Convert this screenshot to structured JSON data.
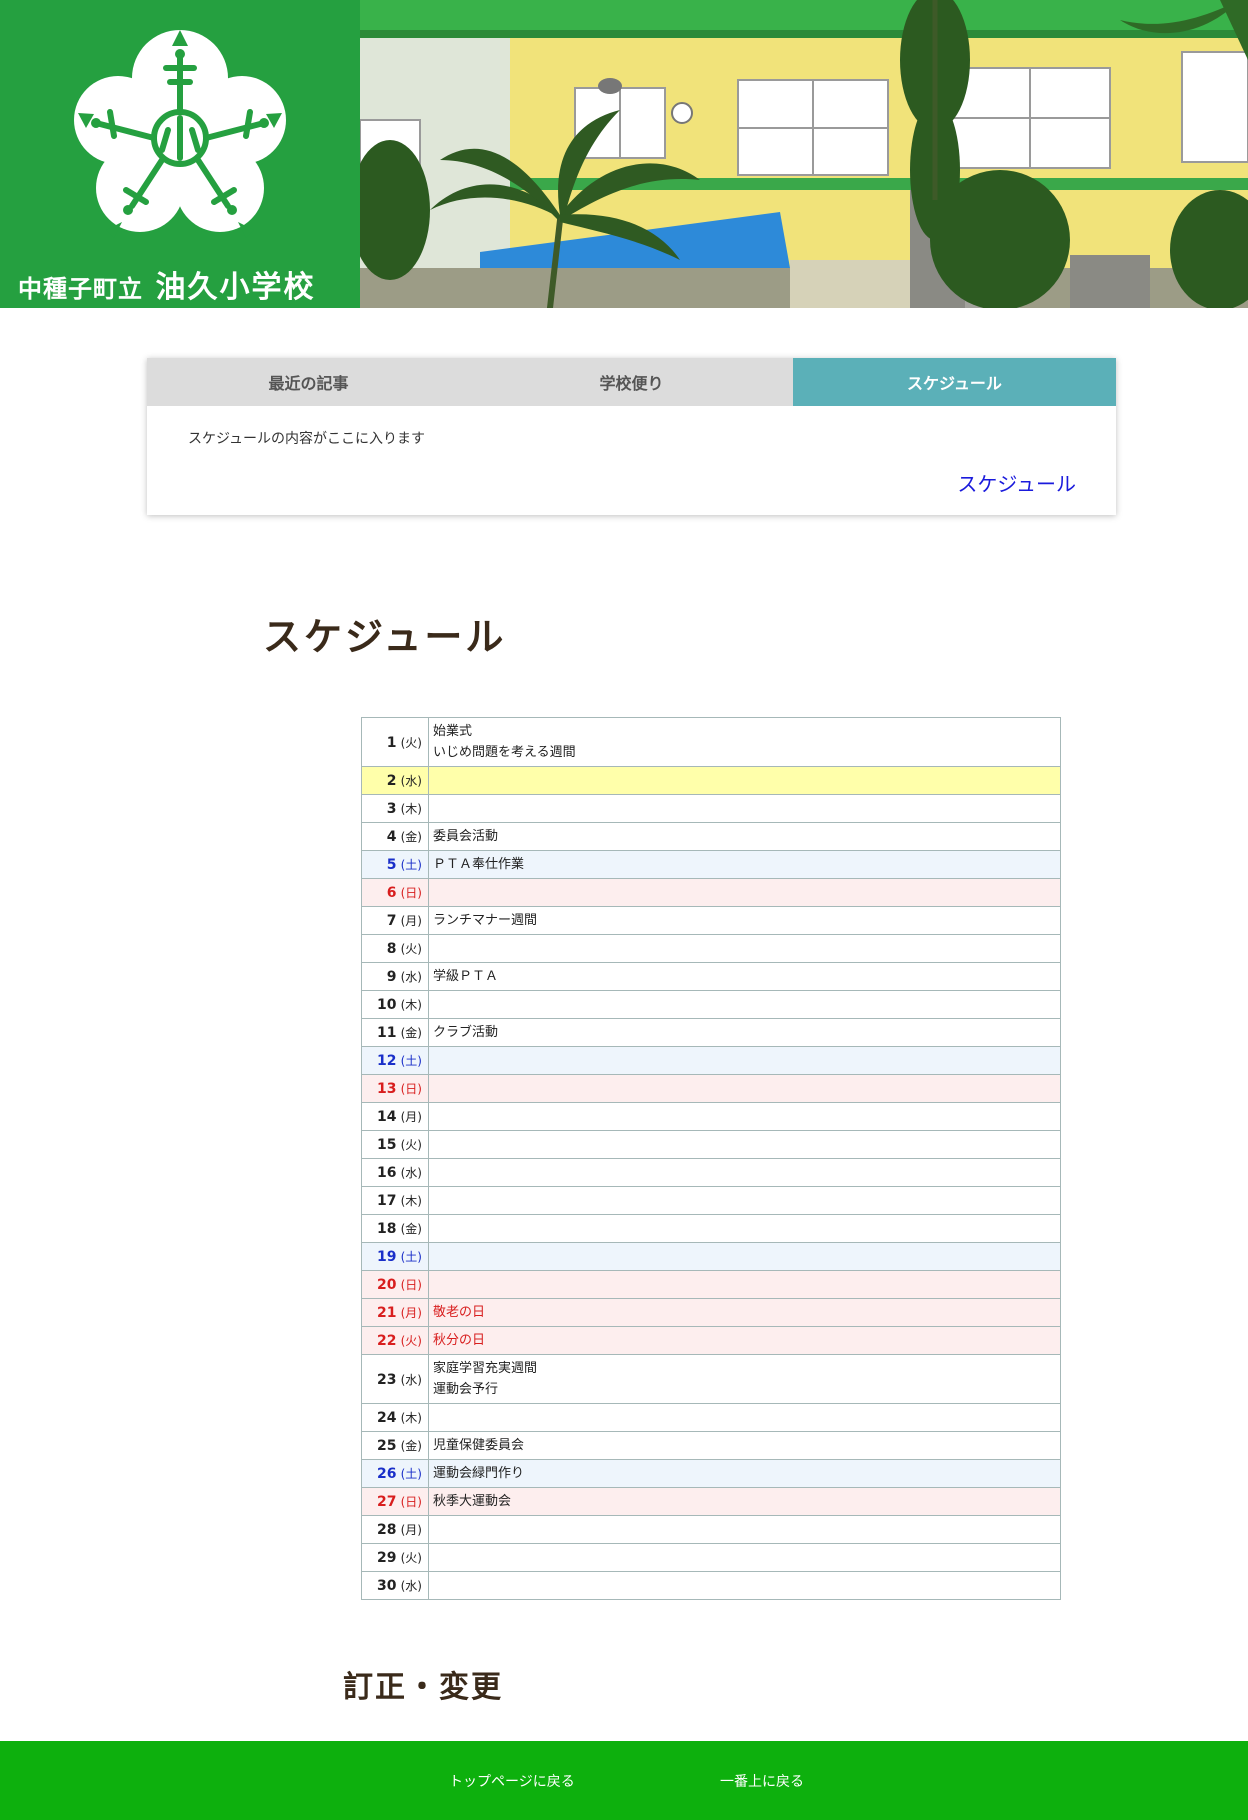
{
  "header": {
    "school_prefix": "中種子町立",
    "school_name": "油久小学校"
  },
  "tabs": {
    "items": [
      {
        "label": "最近の記事"
      },
      {
        "label": "学校便り"
      },
      {
        "label": "スケジュール"
      }
    ],
    "active_index": 2,
    "content_text": "スケジュールの内容がここに入ります",
    "more_link": "スケジュール"
  },
  "schedule": {
    "title": "スケジュール",
    "rows": [
      {
        "day": "1",
        "weekday": "(火)",
        "events": [
          "始業式",
          "いじめ問題を考える週間"
        ],
        "kind": "weekday"
      },
      {
        "day": "2",
        "weekday": "(水)",
        "events": [],
        "kind": "today"
      },
      {
        "day": "3",
        "weekday": "(木)",
        "events": [],
        "kind": "weekday"
      },
      {
        "day": "4",
        "weekday": "(金)",
        "events": [
          "委員会活動"
        ],
        "kind": "weekday"
      },
      {
        "day": "5",
        "weekday": "(土)",
        "events": [
          "ＰＴＡ奉仕作業"
        ],
        "kind": "sat"
      },
      {
        "day": "6",
        "weekday": "(日)",
        "events": [],
        "kind": "sun"
      },
      {
        "day": "7",
        "weekday": "(月)",
        "events": [
          "ランチマナー週間"
        ],
        "kind": "weekday"
      },
      {
        "day": "8",
        "weekday": "(火)",
        "events": [],
        "kind": "weekday"
      },
      {
        "day": "9",
        "weekday": "(水)",
        "events": [
          "学級ＰＴＡ"
        ],
        "kind": "weekday"
      },
      {
        "day": "10",
        "weekday": "(木)",
        "events": [],
        "kind": "weekday"
      },
      {
        "day": "11",
        "weekday": "(金)",
        "events": [
          "クラブ活動"
        ],
        "kind": "weekday"
      },
      {
        "day": "12",
        "weekday": "(土)",
        "events": [],
        "kind": "sat"
      },
      {
        "day": "13",
        "weekday": "(日)",
        "events": [],
        "kind": "sun"
      },
      {
        "day": "14",
        "weekday": "(月)",
        "events": [],
        "kind": "weekday"
      },
      {
        "day": "15",
        "weekday": "(火)",
        "events": [],
        "kind": "weekday"
      },
      {
        "day": "16",
        "weekday": "(水)",
        "events": [],
        "kind": "weekday"
      },
      {
        "day": "17",
        "weekday": "(木)",
        "events": [],
        "kind": "weekday"
      },
      {
        "day": "18",
        "weekday": "(金)",
        "events": [],
        "kind": "weekday"
      },
      {
        "day": "19",
        "weekday": "(土)",
        "events": [],
        "kind": "sat"
      },
      {
        "day": "20",
        "weekday": "(日)",
        "events": [],
        "kind": "sun"
      },
      {
        "day": "21",
        "weekday": "(月)",
        "events": [
          "敬老の日"
        ],
        "kind": "hol"
      },
      {
        "day": "22",
        "weekday": "(火)",
        "events": [
          "秋分の日"
        ],
        "kind": "hol"
      },
      {
        "day": "23",
        "weekday": "(水)",
        "events": [
          "家庭学習充実週間",
          "運動会予行"
        ],
        "kind": "weekday"
      },
      {
        "day": "24",
        "weekday": "(木)",
        "events": [],
        "kind": "weekday"
      },
      {
        "day": "25",
        "weekday": "(金)",
        "events": [
          "児童保健委員会"
        ],
        "kind": "weekday"
      },
      {
        "day": "26",
        "weekday": "(土)",
        "events": [
          "運動会緑門作り"
        ],
        "kind": "sat"
      },
      {
        "day": "27",
        "weekday": "(日)",
        "events": [
          "秋季大運動会"
        ],
        "kind": "sun"
      },
      {
        "day": "28",
        "weekday": "(月)",
        "events": [],
        "kind": "weekday"
      },
      {
        "day": "29",
        "weekday": "(火)",
        "events": [],
        "kind": "weekday"
      },
      {
        "day": "30",
        "weekday": "(水)",
        "events": [],
        "kind": "weekday"
      }
    ]
  },
  "corrections": {
    "title": "訂正・変更"
  },
  "footer": {
    "top_page": "トップページに戻る",
    "back_to_top": "一番上に戻る"
  },
  "colors": {
    "brand_green": "#25a040",
    "tab_active": "#5bb0b8",
    "footer_green": "#0db00d",
    "today": "#ffffaa",
    "saturday_text": "#1a2fc9",
    "sunday_text": "#d81e1e"
  }
}
